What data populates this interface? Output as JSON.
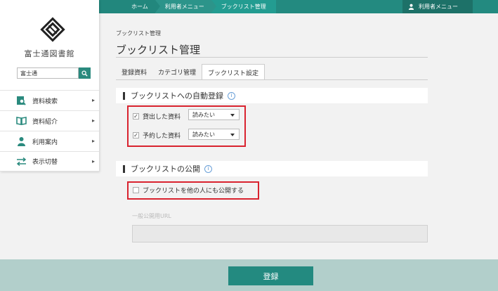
{
  "breadcrumb": [
    "ホーム",
    "利用者メニュー",
    "ブックリスト管理"
  ],
  "user_menu": {
    "label": "利用者メニュー",
    "icon": "user-icon"
  },
  "sidebar": {
    "library_name": "富士通図書館",
    "search": {
      "value": "富士通",
      "icon": "search-icon"
    },
    "items": [
      {
        "label": "資料検索",
        "icon": "book-search-icon"
      },
      {
        "label": "資料紹介",
        "icon": "open-book-icon"
      },
      {
        "label": "利用案内",
        "icon": "person-icon"
      },
      {
        "label": "表示切替",
        "icon": "switch-arrows-icon"
      }
    ]
  },
  "page": {
    "breadcrumb_small": "ブックリスト管理",
    "title": "ブックリスト管理",
    "tabs": [
      {
        "label": "登録資料",
        "active": false
      },
      {
        "label": "カテゴリ管理",
        "active": false
      },
      {
        "label": "ブックリスト設定",
        "active": true
      }
    ]
  },
  "auto_register": {
    "heading": "ブックリストへの自動登録",
    "rows": [
      {
        "label": "貸出した資料",
        "checked": true,
        "select": "読みたい"
      },
      {
        "label": "予約した資料",
        "checked": true,
        "select": "読みたい"
      }
    ]
  },
  "publish": {
    "heading": "ブックリストの公開",
    "checkbox_label": "ブックリストを他の人にも公開する",
    "checked": false,
    "url_label": "一般公開用URL",
    "url_value": ""
  },
  "submit_label": "登録",
  "colors": {
    "accent": "#238a80",
    "highlight": "#d9232f"
  }
}
